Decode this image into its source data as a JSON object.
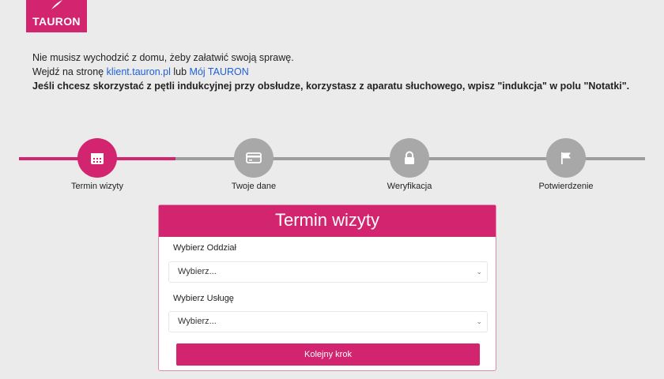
{
  "brand": {
    "name": "TAURON",
    "color": "#d2246f"
  },
  "intro": {
    "line1": "Nie musisz wychodzić z domu, żeby załatwić swoją sprawę.",
    "line2_prefix": "Wejdź na stronę ",
    "link1": "klient.tauron.pl",
    "line2_mid": " lub ",
    "link2": "Mój TAURON",
    "line3": "Jeśli chcesz skorzystać z pętli indukcyjnej przy obsłudze, korzystasz z aparatu słuchowego, wpisz \"indukcja\" w polu \"Notatki\"."
  },
  "steps": [
    {
      "label": "Termin wizyty",
      "icon": "calendar-icon",
      "active": true
    },
    {
      "label": "Twoje dane",
      "icon": "card-icon",
      "active": false
    },
    {
      "label": "Weryfikacja",
      "icon": "lock-icon",
      "active": false
    },
    {
      "label": "Potwierdzenie",
      "icon": "flag-icon",
      "active": false
    }
  ],
  "form": {
    "title": "Termin wizyty",
    "branch_label": "Wybierz Oddział",
    "branch_value": "Wybierz...",
    "service_label": "Wybierz Usługę",
    "service_value": "Wybierz...",
    "next_label": "Kolejny krok"
  }
}
